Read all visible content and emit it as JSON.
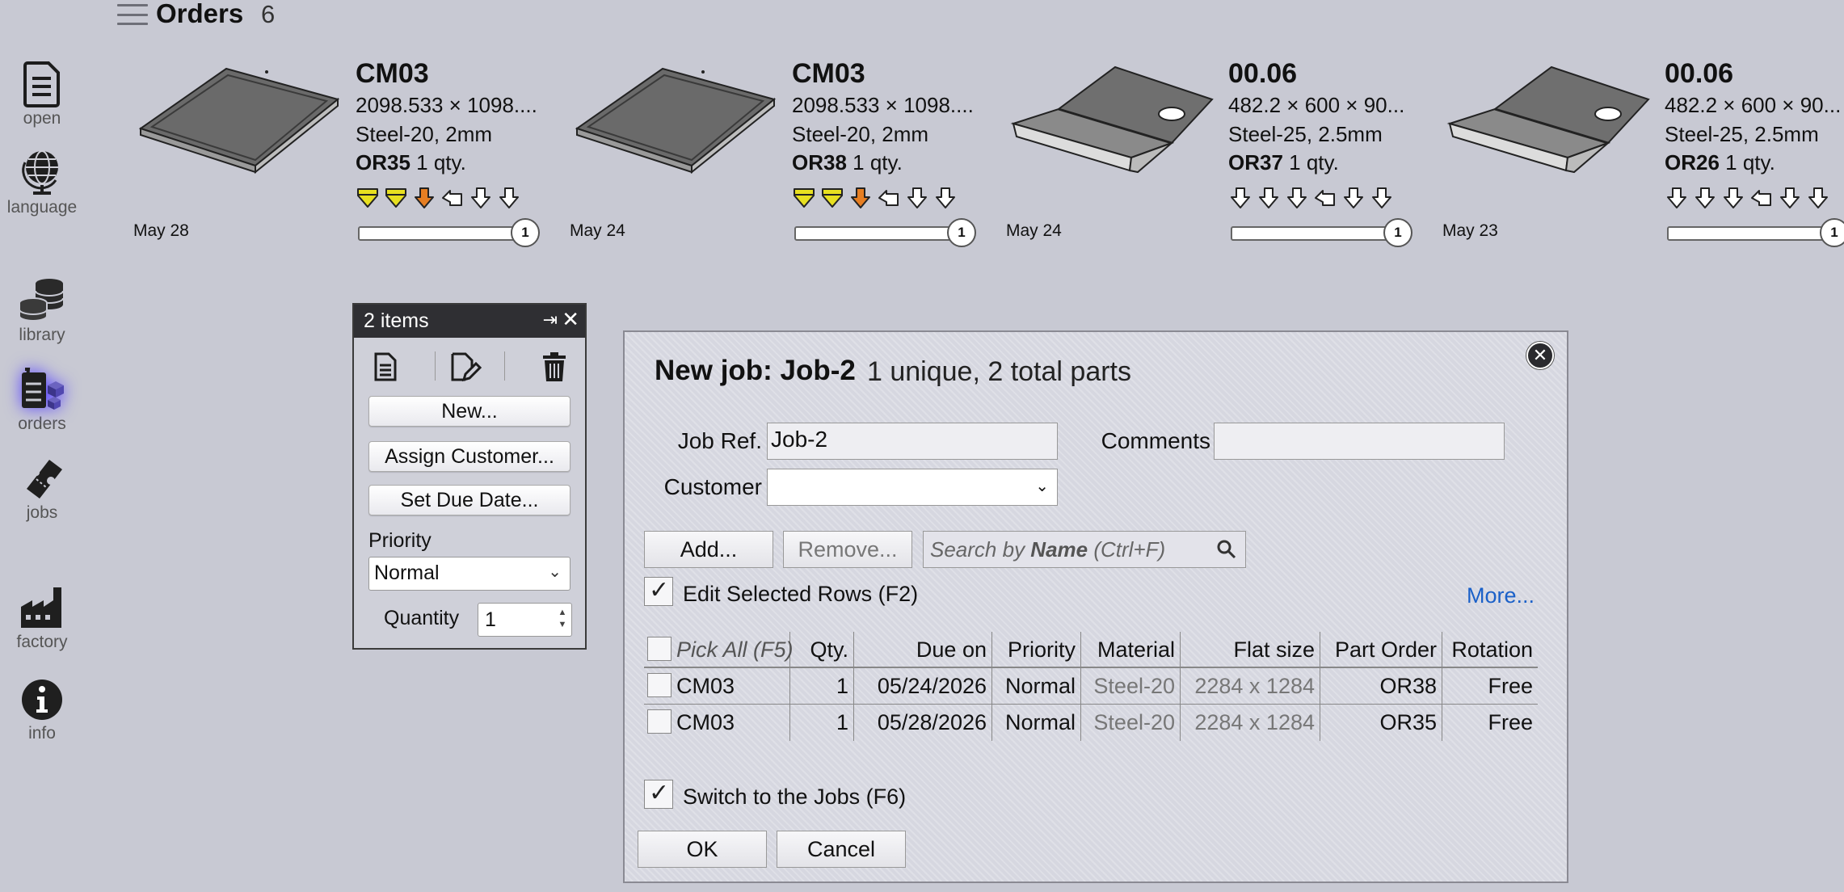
{
  "header": {
    "title": "Orders",
    "count": "6"
  },
  "nav": [
    {
      "label": "open",
      "icon": "document-icon"
    },
    {
      "label": "language",
      "icon": "globe-icon"
    },
    {
      "label": "library",
      "icon": "database-icon"
    },
    {
      "label": "orders",
      "icon": "orders-icon",
      "active": true
    },
    {
      "label": "jobs",
      "icon": "ticket-icon"
    },
    {
      "label": "factory",
      "icon": "factory-icon"
    },
    {
      "label": "info",
      "icon": "info-icon"
    }
  ],
  "orders": [
    {
      "code": "CM03",
      "dims": "2098.533 × 1098....",
      "material": "Steel-20, 2mm",
      "order_id": "OR35",
      "qty": "1 qty.",
      "date": "May 28",
      "progress_label": "1",
      "shape": "flat-plate"
    },
    {
      "code": "CM03",
      "dims": "2098.533 × 1098....",
      "material": "Steel-20, 2mm",
      "order_id": "OR38",
      "qty": "1 qty.",
      "date": "May 24",
      "progress_label": "1",
      "shape": "flat-plate"
    },
    {
      "code": "00.06",
      "dims": "482.2 × 600 × 90...",
      "material": "Steel-25, 2.5mm",
      "order_id": "OR37",
      "qty": "1 qty.",
      "date": "May 24",
      "progress_label": "1",
      "shape": "bent-bracket"
    },
    {
      "code": "00.06",
      "dims": "482.2 × 600 × 90...",
      "material": "Steel-25, 2.5mm",
      "order_id": "OR26",
      "qty": "1 qty.",
      "date": "May 23",
      "progress_label": "1",
      "shape": "bent-bracket"
    }
  ],
  "status_colors": {
    "yellow": "#e8e020",
    "orange": "#e67e22",
    "empty": "#ffffff"
  },
  "items_panel": {
    "title": "2 items",
    "new_label": "New...",
    "assign_customer_label": "Assign Customer...",
    "set_due_date_label": "Set Due Date...",
    "priority_label": "Priority",
    "priority_value": "Normal",
    "quantity_label": "Quantity",
    "quantity_value": "1"
  },
  "dialog": {
    "title": "New job: Job-2",
    "subtitle": "1 unique, 2 total parts",
    "job_ref_label": "Job Ref.",
    "job_ref_value": "Job-2",
    "comments_label": "Comments",
    "comments_value": "",
    "customer_label": "Customer",
    "customer_value": "",
    "add_label": "Add...",
    "remove_label": "Remove...",
    "search_prefix": "Search by ",
    "search_bold": "Name",
    "search_suffix": " (Ctrl+F)",
    "edit_selected_label": "Edit Selected Rows (F2)",
    "more_label": "More...",
    "switch_jobs_label": "Switch to the Jobs (F6)",
    "ok_label": "OK",
    "cancel_label": "Cancel"
  },
  "table": {
    "headers": [
      "Pick All (F5)",
      "Qty.",
      "Due on",
      "Priority",
      "Material",
      "Flat size",
      "Part Order",
      "Rotation"
    ],
    "rows": [
      [
        "CM03",
        "1",
        "05/24/2026",
        "Normal",
        "Steel-20",
        "2284 x 1284",
        "OR38",
        "Free"
      ],
      [
        "CM03",
        "1",
        "05/28/2026",
        "Normal",
        "Steel-20",
        "2284 x 1284",
        "OR35",
        "Free"
      ]
    ]
  }
}
